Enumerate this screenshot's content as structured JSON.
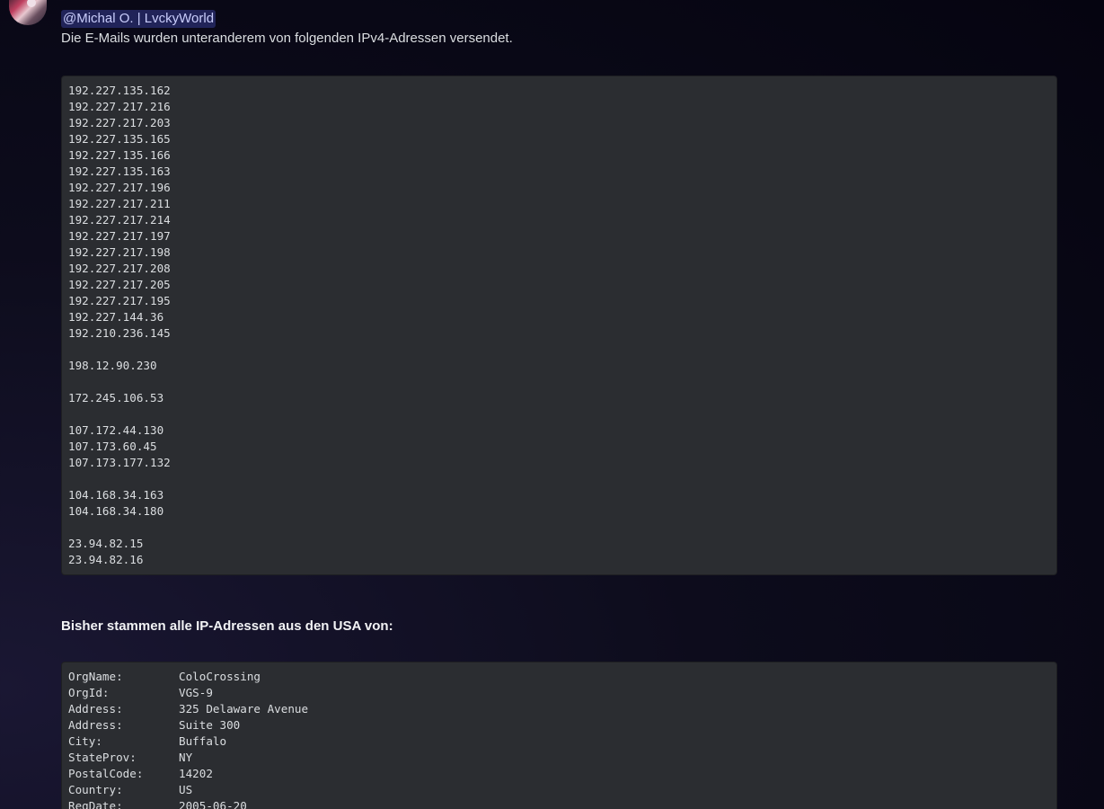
{
  "message": {
    "mention": "@Michal O. | LvckyWorld",
    "text": "Die E-Mails wurden unteranderem von folgenden IPv4-Adressen versendet."
  },
  "ip_groups": [
    [
      "192.227.135.162",
      "192.227.217.216",
      "192.227.217.203",
      "192.227.135.165",
      "192.227.135.166",
      "192.227.135.163",
      "192.227.217.196",
      "192.227.217.211",
      "192.227.217.214",
      "192.227.217.197",
      "192.227.217.198",
      "192.227.217.208",
      "192.227.217.205",
      "192.227.217.195",
      "192.227.144.36",
      "192.210.236.145"
    ],
    [
      "198.12.90.230"
    ],
    [
      "172.245.106.53"
    ],
    [
      "107.172.44.130",
      "107.173.60.45",
      "107.173.177.132"
    ],
    [
      "104.168.34.163",
      "104.168.34.180"
    ],
    [
      "23.94.82.15",
      "23.94.82.16"
    ]
  ],
  "heading": "Bisher stammen alle IP-Adressen aus den USA von:",
  "whois": [
    {
      "key": "OrgName:",
      "value": "ColoCrossing"
    },
    {
      "key": "OrgId:",
      "value": "VGS-9"
    },
    {
      "key": "Address:",
      "value": "325 Delaware Avenue"
    },
    {
      "key": "Address:",
      "value": "Suite 300"
    },
    {
      "key": "City:",
      "value": "Buffalo"
    },
    {
      "key": "StateProv:",
      "value": "NY"
    },
    {
      "key": "PostalCode:",
      "value": "14202"
    },
    {
      "key": "Country:",
      "value": "US"
    },
    {
      "key": "RegDate:",
      "value": "2005-06-20"
    }
  ]
}
